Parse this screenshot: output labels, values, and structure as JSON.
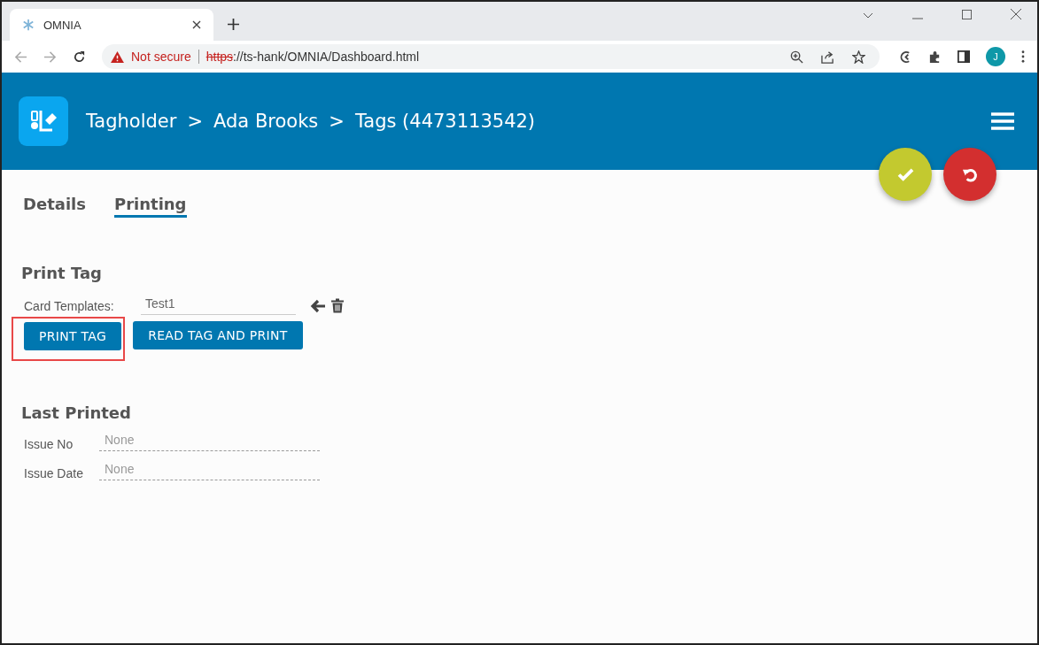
{
  "browser": {
    "tab_title": "OMNIA",
    "security": "Not secure",
    "url_scheme": "https",
    "url_rest": "://ts-hank/OMNIA/Dashboard.html",
    "profile_initial": "J"
  },
  "header": {
    "breadcrumbs": [
      "Tagholder",
      ">",
      "Ada Brooks",
      ">",
      "Tags (4473113542)"
    ]
  },
  "tabs": [
    {
      "label": "Details",
      "selected": false
    },
    {
      "label": "Printing",
      "selected": true
    }
  ],
  "print_tag": {
    "title": "Print Tag",
    "template_label": "Card Templates:",
    "template_value": "Test1",
    "buttons": [
      {
        "label": "PRINT TAG",
        "highlighted": true
      },
      {
        "label": "READ TAG AND PRINT",
        "highlighted": false
      }
    ]
  },
  "last_printed": {
    "title": "Last Printed",
    "fields": [
      {
        "label": "Issue No",
        "value": "None"
      },
      {
        "label": "Issue Date",
        "value": "None"
      }
    ]
  }
}
